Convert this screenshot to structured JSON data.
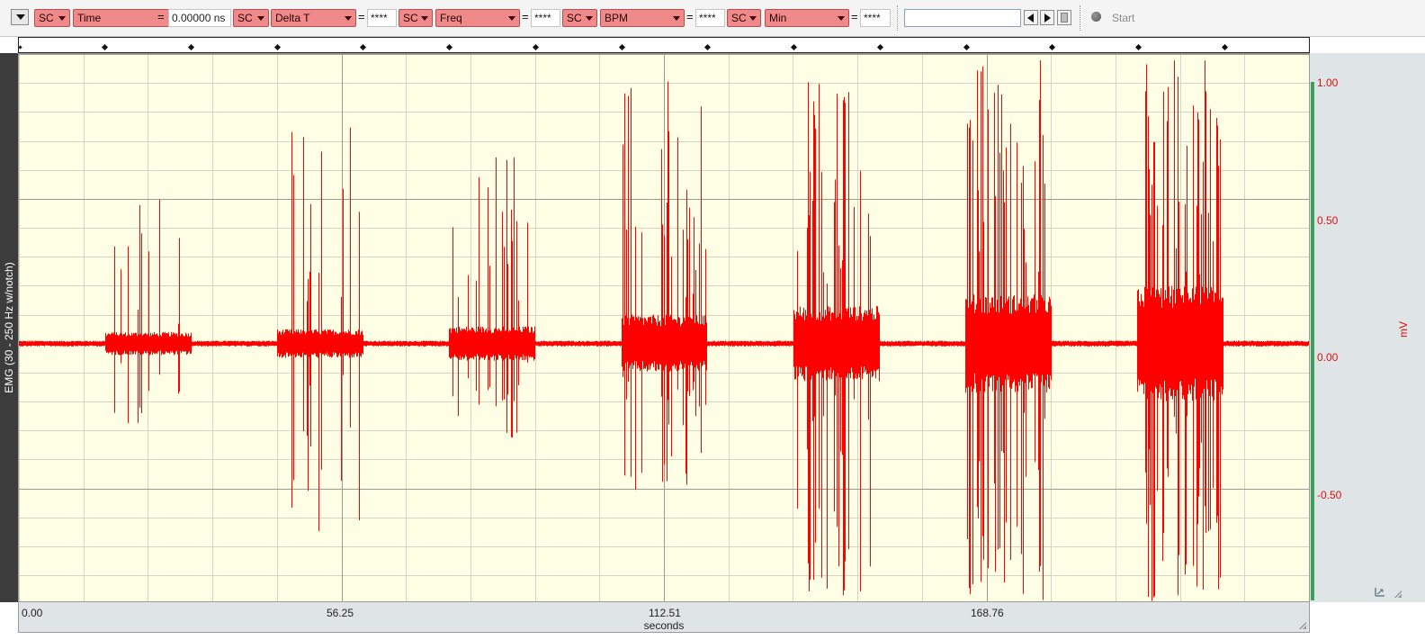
{
  "toolbar": {
    "measurements": [
      {
        "channel": "SC",
        "type": "Time",
        "value": "0.00000 ns"
      },
      {
        "channel": "SC",
        "type": "Delta T",
        "value": "****"
      },
      {
        "channel": "SC",
        "type": "Freq",
        "value": "****"
      },
      {
        "channel": "SC",
        "type": "BPM",
        "value": "****"
      },
      {
        "channel": "SC",
        "type": "Min",
        "value": "****"
      }
    ],
    "equals": "=",
    "search": {
      "value": ""
    },
    "start_label": "Start"
  },
  "channel": {
    "label": "EMG (30 - 250 Hz w/notch)"
  },
  "colors": {
    "trace": "#ff0000",
    "plot_bg": "#ffffe6",
    "grid": "#d4d4c6",
    "axis_text": "#e01010",
    "accent_green": "#3aa05a"
  },
  "chart_data": {
    "type": "line",
    "xlabel": "seconds",
    "ylabel": "mV",
    "xlim": [
      0.0,
      225.0
    ],
    "ylim": [
      -0.89,
      1.0
    ],
    "x_ticks": [
      "0.00",
      "56.25",
      "112.51",
      "168.76"
    ],
    "y_ticks": [
      "1.00",
      "0.50",
      "0.00",
      "-0.50"
    ],
    "grid": true,
    "series": [
      {
        "color": "#ff0000",
        "baseline_noise_mV": 0.01,
        "bursts": [
          {
            "start": 15.0,
            "end": 30.0,
            "amplitude_mV": 0.04,
            "spike_max_mV": 0.5,
            "spike_min_mV": -0.28
          },
          {
            "start": 45.0,
            "end": 60.0,
            "amplitude_mV": 0.05,
            "spike_max_mV": 0.8,
            "spike_min_mV": -0.65
          },
          {
            "start": 75.0,
            "end": 90.0,
            "amplitude_mV": 0.06,
            "spike_max_mV": 0.67,
            "spike_min_mV": -0.33
          },
          {
            "start": 105.0,
            "end": 120.0,
            "amplitude_mV": 0.1,
            "spike_max_mV": 0.92,
            "spike_min_mV": -0.51
          },
          {
            "start": 135.0,
            "end": 150.0,
            "amplitude_mV": 0.13,
            "spike_max_mV": 0.93,
            "spike_min_mV": -0.89
          },
          {
            "start": 165.0,
            "end": 180.0,
            "amplitude_mV": 0.17,
            "spike_max_mV": 0.98,
            "spike_min_mV": -0.89
          },
          {
            "start": 195.0,
            "end": 210.0,
            "amplitude_mV": 0.2,
            "spike_max_mV": 0.98,
            "spike_min_mV": -0.89
          }
        ]
      }
    ]
  }
}
